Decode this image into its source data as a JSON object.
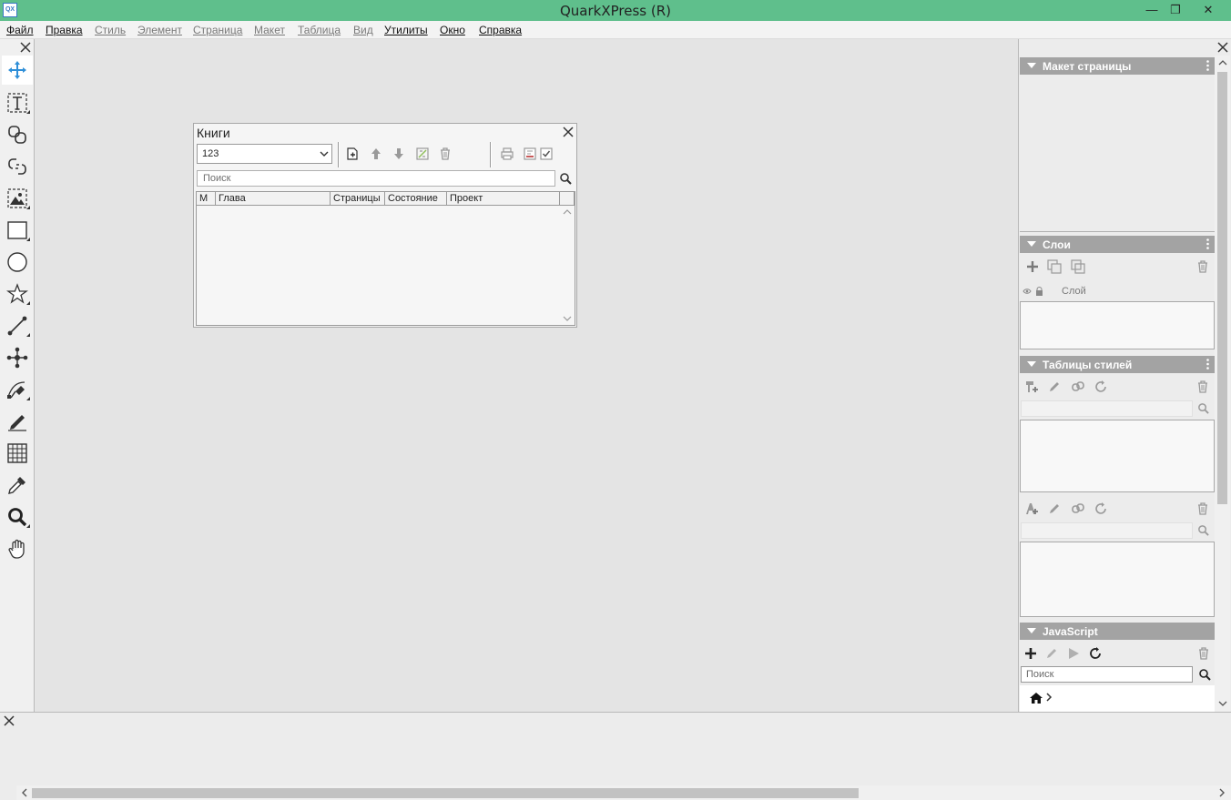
{
  "window": {
    "title": "QuarkXPress (R)",
    "app_icon_text": "QX",
    "minimize": "—",
    "maximize": "❐",
    "close": "✕"
  },
  "menu": [
    {
      "label": "Файл",
      "enabled": true
    },
    {
      "label": "Правка",
      "enabled": true
    },
    {
      "label": "Стиль",
      "enabled": false
    },
    {
      "label": "Элемент",
      "enabled": false
    },
    {
      "label": "Страница",
      "enabled": false
    },
    {
      "label": "Макет",
      "enabled": false
    },
    {
      "label": "Таблица",
      "enabled": false
    },
    {
      "label": "Вид",
      "enabled": false
    },
    {
      "label": "Утилиты",
      "enabled": true
    },
    {
      "label": "Окно",
      "enabled": true
    },
    {
      "label": "Справка",
      "enabled": true
    }
  ],
  "tools": [
    {
      "name": "move-tool-icon",
      "active": true
    },
    {
      "name": "text-content-tool-icon",
      "submenu": true
    },
    {
      "name": "text-linking-tool-icon"
    },
    {
      "name": "text-unlinking-tool-icon"
    },
    {
      "name": "picture-content-tool-icon",
      "submenu": true
    },
    {
      "name": "rectangle-box-tool-icon",
      "submenu": true
    },
    {
      "name": "oval-box-tool-icon"
    },
    {
      "name": "starburst-tool-icon",
      "submenu": true
    },
    {
      "name": "line-tool-icon",
      "submenu": true
    },
    {
      "name": "point-tool-icon"
    },
    {
      "name": "bezier-pen-tool-icon",
      "submenu": true
    },
    {
      "name": "freehand-tool-icon"
    },
    {
      "name": "table-tool-icon"
    },
    {
      "name": "eyedropper-tool-icon"
    },
    {
      "name": "zoom-tool-icon",
      "submenu": true
    },
    {
      "name": "pan-tool-icon"
    }
  ],
  "books_palette": {
    "title": "Книги",
    "book_select_value": "123",
    "search_placeholder": "Поиск",
    "columns": [
      "M",
      "Глава",
      "Страницы",
      "Состояние",
      "Проект"
    ],
    "rows": []
  },
  "panels": {
    "page_layout": {
      "title": "Макет страницы"
    },
    "layers": {
      "title": "Слои",
      "column_label": "Слой"
    },
    "style_sheets": {
      "title": "Таблицы стилей"
    },
    "javascript": {
      "title": "JavaScript",
      "search_placeholder": "Поиск"
    }
  },
  "colors": {
    "titlebar": "#5fbf8c",
    "active_tool": "#2f8fd8",
    "panel_header": "#a3a3a3"
  }
}
